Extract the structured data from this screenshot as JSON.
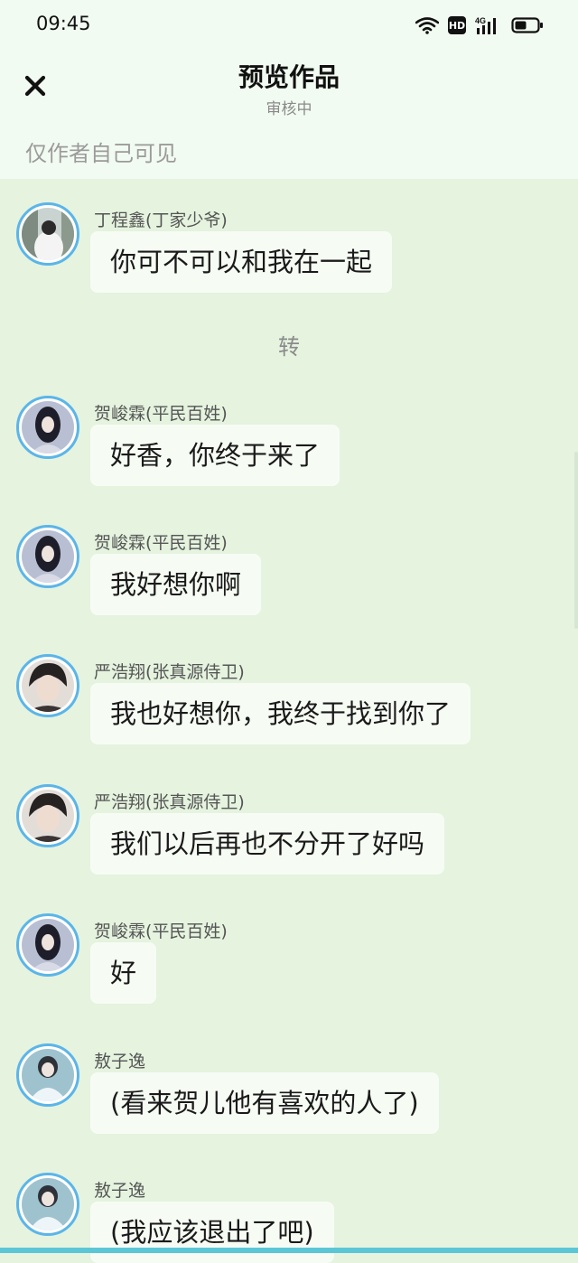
{
  "status_bar": {
    "time": "09:45",
    "hd": "HD",
    "network": "4G"
  },
  "header": {
    "title": "预览作品",
    "subtitle": "审核中",
    "visibility_note": "仅作者自己可见"
  },
  "messages": [
    {
      "sender": "丁程鑫(丁家少爷)",
      "text": "你可不可以和我在一起"
    },
    {
      "sender": "贺峻霖(平民百姓)",
      "text": "好香，你终于来了"
    },
    {
      "sender": "贺峻霖(平民百姓)",
      "text": "我好想你啊"
    },
    {
      "sender": "严浩翔(张真源侍卫)",
      "text": "我也好想你，我终于找到你了"
    },
    {
      "sender": "严浩翔(张真源侍卫)",
      "text": "我们以后再也不分开了好吗"
    },
    {
      "sender": "贺峻霖(平民百姓)",
      "text": "好"
    },
    {
      "sender": "敖子逸",
      "text": "(看来贺儿他有喜欢的人了)"
    },
    {
      "sender": "敖子逸",
      "text": "(我应该退出了吧)"
    }
  ],
  "divider": "转",
  "colors": {
    "header_bg": "#f2fbf1",
    "chat_bg": "#e5f3df",
    "avatar_ring": "#5bb5e8",
    "bubble_bg": "#f6fcf4"
  }
}
